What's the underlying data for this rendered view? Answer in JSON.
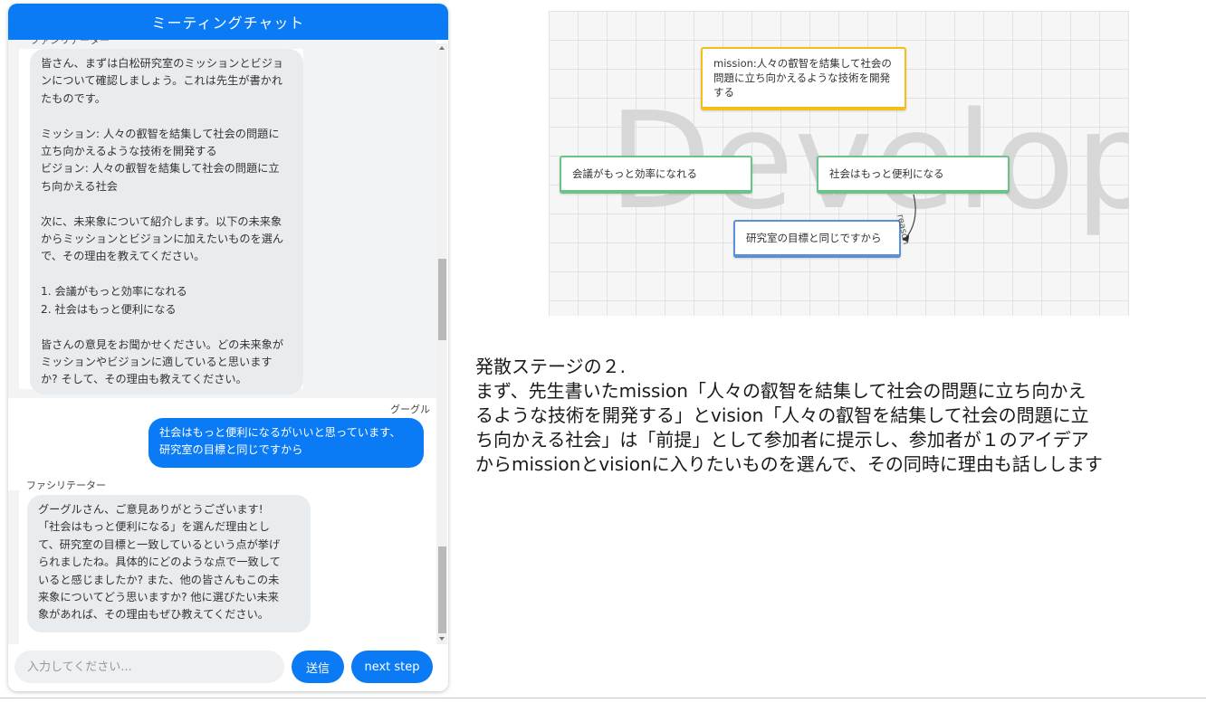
{
  "chat": {
    "title": "ミーティングチャット",
    "cut_label": "ファシリテーター",
    "messages": [
      {
        "sender": "ファシリテーター",
        "text": "皆さん、まずは白松研究室のミッションとビジョ\nンについて確認しましょう。これは先生が書かれ\nたものです。\n\nミッション: 人々の叡智を結集して社会の問題に\n立ち向かえるような技術を開発する\nビジョン: 人々の叡智を結集して社会の問題に立\nち向かえる社会\n\n次に、未来象について紹介します。以下の未来象\nからミッションとビジョンに加えたいものを選ん\nで、その理由を教えてください。\n\n1. 会議がもっと効率になれる\n2. 社会はもっと便利になる\n\n皆さんの意見をお聞かせください。どの未来象が\nミッションやビジョンに適していると思います\nか? そして、その理由も教えてください。"
      },
      {
        "sender": "グーグル",
        "text": "社会はもっと便利になるがいいと思っています、\n研究室の目標と同じですから"
      },
      {
        "sender": "ファシリテーター",
        "text": "グーグルさん、ご意見ありがとうございます!\n「社会はもっと便利になる」を選んだ理由とし\nて、研究室の目標と一致しているという点が挙げ\nられましたね。具体的にどのような点で一致して\nいると感じましたか? また、他の皆さんもこの未\n来象についてどう思いますか? 他に選びたい未来\n象があれば、その理由もぜひ教えてください。"
      }
    ],
    "input_placeholder": "入力してください...",
    "send_label": "送信",
    "next_label": "next step"
  },
  "diagram": {
    "watermark": "Develop",
    "nodes": {
      "mission": "mission:人々の叡智を結集して社会の\n問題に立ち向かえるような技術を開発\nする",
      "future1": "会議がもっと効率になれる",
      "future2": "社会はもっと便利になる",
      "reason": "研究室の目標と同じですから"
    },
    "edge_label": "reason"
  },
  "description": {
    "lines": [
      "発散ステージの２.",
      "まず、先生書いたmission「人々の叡智を結集して社会の問題に立ち向かえ",
      "るような技術を開発する」とvision「人々の叡智を結集して社会の問題に立",
      "ち向かえる社会」は「前提」として参加者に提示し、参加者が１のアイデア",
      "からmissionとvisionに入りたいものを選んで、その同時に理由も話しします"
    ]
  },
  "colors": {
    "accent": "#0a7bf5",
    "bubble_gray": "#e9ecef",
    "node_yellow": "#f4bf19",
    "node_green": "#6cc38a",
    "node_blue": "#5b8fd6"
  }
}
